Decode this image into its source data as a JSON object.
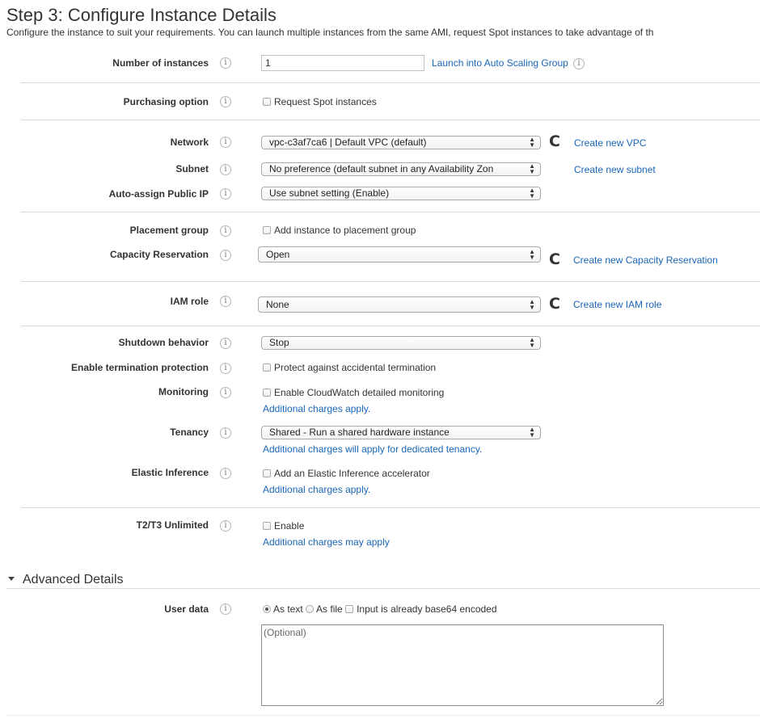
{
  "page": {
    "title": "Step 3: Configure Instance Details",
    "subtitle": "Configure the instance to suit your requirements. You can launch multiple instances from the same AMI, request Spot instances to take advantage of th"
  },
  "colors": {
    "link": "#1a66b7",
    "text": "#333333",
    "separator": "#d9d9d9"
  },
  "icons": {
    "info": "i",
    "refresh": "C",
    "select_arrows": "▲▼"
  },
  "fields": {
    "instances": {
      "label": "Number of instances",
      "value": "1",
      "link": "Launch into Auto Scaling Group"
    },
    "purchasing": {
      "label": "Purchasing option",
      "checkbox": "Request Spot instances",
      "checked": false
    },
    "network": {
      "label": "Network",
      "selected": "vpc-c3af7ca6 | Default VPC (default)",
      "link": "Create new VPC"
    },
    "subnet": {
      "label": "Subnet",
      "selected": "No preference (default subnet in any Availability Zon",
      "link": "Create new subnet"
    },
    "public_ip": {
      "label": "Auto-assign Public IP",
      "selected": "Use subnet setting (Enable)"
    },
    "placement": {
      "label": "Placement group",
      "checkbox": "Add instance to placement group",
      "checked": false
    },
    "capacity": {
      "label": "Capacity Reservation",
      "selected": "Open",
      "link": "Create new Capacity Reservation"
    },
    "iam": {
      "label": "IAM role",
      "selected": "None",
      "link": "Create new IAM role"
    },
    "shutdown": {
      "label": "Shutdown behavior",
      "selected": "Stop"
    },
    "termination": {
      "label": "Enable termination protection",
      "checkbox": "Protect against accidental termination",
      "checked": false
    },
    "monitoring": {
      "label": "Monitoring",
      "checkbox": "Enable CloudWatch detailed monitoring",
      "checked": false,
      "note": "Additional charges apply."
    },
    "tenancy": {
      "label": "Tenancy",
      "selected": "Shared - Run a shared hardware instance",
      "note": "Additional charges will apply for dedicated tenancy."
    },
    "elastic": {
      "label": "Elastic Inference",
      "checkbox": "Add an Elastic Inference accelerator",
      "checked": false,
      "note": "Additional charges apply."
    },
    "unlimited": {
      "label": "T2/T3 Unlimited",
      "checkbox": "Enable",
      "checked": false,
      "note": "Additional charges may apply"
    }
  },
  "advanced": {
    "heading": "Advanced Details",
    "expanded": true,
    "user_data": {
      "label": "User data",
      "radio_text": "As text",
      "radio_file": "As file",
      "selected": "As text",
      "base64_checkbox": "Input is already base64 encoded",
      "base64_checked": false,
      "placeholder": "(Optional)",
      "value": ""
    }
  }
}
